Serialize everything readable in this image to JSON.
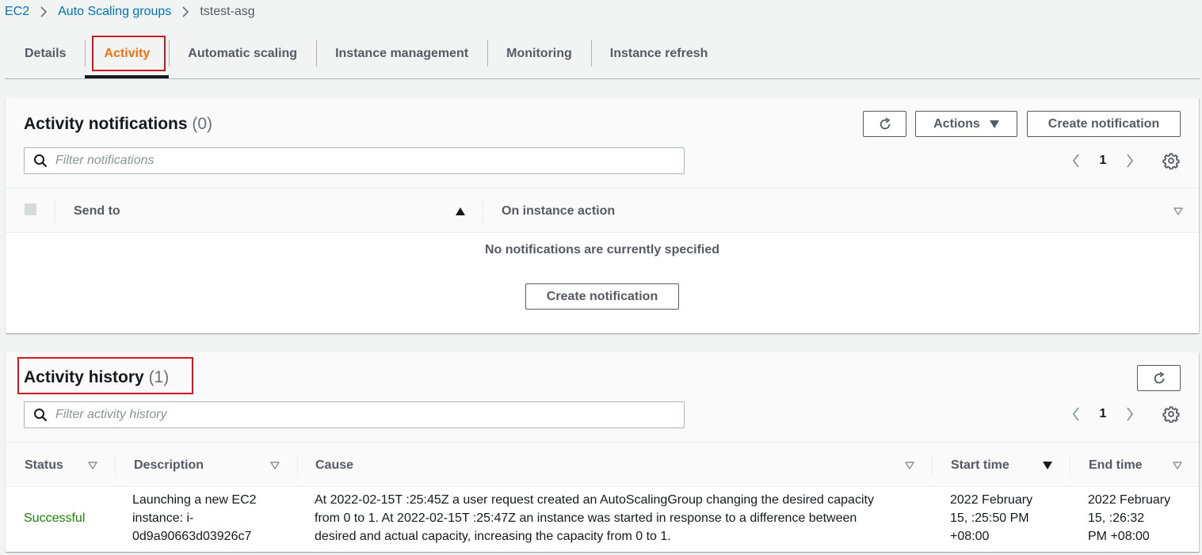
{
  "breadcrumb": {
    "items": [
      "EC2",
      "Auto Scaling groups"
    ],
    "current": "tstest-asg"
  },
  "tabs": [
    {
      "label": "Details",
      "active": false
    },
    {
      "label": "Activity",
      "active": true
    },
    {
      "label": "Automatic scaling",
      "active": false
    },
    {
      "label": "Instance management",
      "active": false
    },
    {
      "label": "Monitoring",
      "active": false
    },
    {
      "label": "Instance refresh",
      "active": false
    }
  ],
  "notifications": {
    "title": "Activity notifications",
    "count": "(0)",
    "actions_label": "Actions",
    "create_label": "Create notification",
    "filter_placeholder": "Filter notifications",
    "page": "1",
    "columns": {
      "send_to": "Send to",
      "on_instance_action": "On instance action"
    },
    "empty_message": "No notifications are currently specified",
    "empty_create_label": "Create notification"
  },
  "history": {
    "title": "Activity history",
    "count": "(1)",
    "filter_placeholder": "Filter activity history",
    "page": "1",
    "columns": {
      "status": "Status",
      "description": "Description",
      "cause": "Cause",
      "start_time": "Start time",
      "end_time": "End time"
    },
    "rows": [
      {
        "status": "Successful",
        "description": [
          "Launching a new EC2",
          "instance: i-",
          "0d9a90663d03926c7"
        ],
        "cause": [
          "At 2022-02-15T  :25:45Z a user request created an AutoScalingGroup changing the desired capacity",
          "from 0 to 1. At 2022-02-15T  :25:47Z an instance was started in response to a difference between",
          "desired and actual capacity, increasing the capacity from 0 to 1."
        ],
        "start_time": [
          "2022 February",
          "15,   :25:50 PM",
          "+08:00"
        ],
        "end_time": [
          "2022 February",
          "15,   :26:32",
          "PM +08:00"
        ]
      }
    ]
  },
  "colors": {
    "accent": "#ec7211",
    "link": "#0073bb",
    "success": "#1d8102",
    "highlight": "#d0171b"
  }
}
